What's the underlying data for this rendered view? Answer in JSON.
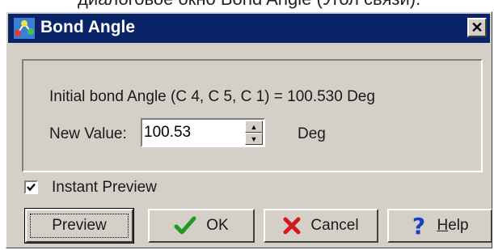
{
  "background_caption": "диалоговое окно Bond Angle (Угол связи).",
  "dialog": {
    "title": "Bond Angle",
    "close_label": "✕"
  },
  "initial": {
    "text": "Initial bond Angle (C 4, C 5, C 1) = 100.530 Deg"
  },
  "new_value": {
    "label": "New Value:",
    "value": "100.53",
    "unit": "Deg"
  },
  "instant_preview": {
    "label": "Instant Preview",
    "checked": true
  },
  "buttons": {
    "preview": "Preview",
    "ok": "OK",
    "cancel": "Cancel",
    "help_accel": "H",
    "help_rest": "elp"
  },
  "colors": {
    "titlebar": "#0a246a",
    "face": "#d4d0c8",
    "ok_check": "#1f9a1f",
    "cancel_x": "#d21a1a",
    "help_q": "#1a3ec8"
  }
}
